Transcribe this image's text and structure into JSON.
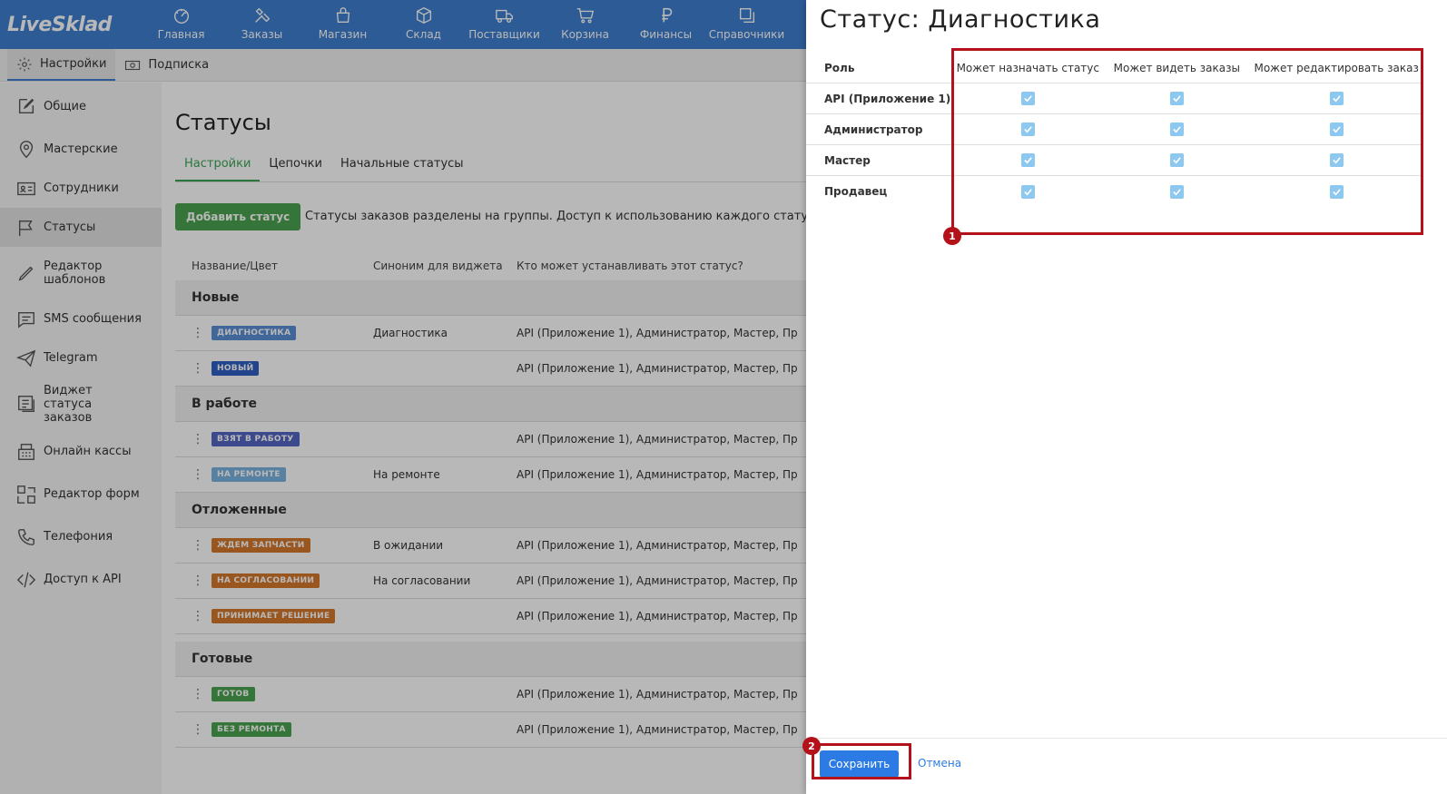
{
  "app": {
    "logo": "LiveSklad"
  },
  "topnav": [
    {
      "label": "Главная",
      "icon": "dashboard-icon"
    },
    {
      "label": "Заказы",
      "icon": "tools-icon"
    },
    {
      "label": "Магазин",
      "icon": "shop-bag-icon"
    },
    {
      "label": "Склад",
      "icon": "box-icon"
    },
    {
      "label": "Поставщики",
      "icon": "truck-icon"
    },
    {
      "label": "Корзина",
      "icon": "cart-icon"
    },
    {
      "label": "Финансы",
      "icon": "ruble-icon"
    },
    {
      "label": "Справочники",
      "icon": "copy-icon"
    }
  ],
  "subbar": {
    "settings_label": "Настройки",
    "subscription_label": "Подписка"
  },
  "sidebar": {
    "items": [
      {
        "label": "Общие",
        "icon": "edit-icon"
      },
      {
        "label": "Мастерские",
        "icon": "location-pin-icon"
      },
      {
        "label": "Сотрудники",
        "icon": "id-card-icon"
      },
      {
        "label": "Статусы",
        "icon": "flag-icon"
      },
      {
        "label": "Редактор шаблонов",
        "icon": "pen-icon"
      },
      {
        "label": "SMS сообщения",
        "icon": "message-icon"
      },
      {
        "label": "Telegram",
        "icon": "send-icon"
      },
      {
        "label": "Виджет статуса заказов",
        "icon": "widget-icon"
      },
      {
        "label": "Онлайн кассы",
        "icon": "cash-register-icon"
      },
      {
        "label": "Редактор форм",
        "icon": "form-editor-icon"
      },
      {
        "label": "Телефония",
        "icon": "phone-icon"
      },
      {
        "label": "Доступ к API",
        "icon": "code-icon"
      }
    ]
  },
  "main": {
    "title": "Статусы",
    "tabs": [
      "Настройки",
      "Цепочки",
      "Начальные статусы"
    ],
    "add_button": "Добавить статус",
    "info_text": "Статусы заказов разделены на группы. Доступ к использованию каждого статуса можно",
    "columns": [
      "Название/Цвет",
      "Синоним для виджета",
      "Кто может устанавливать этот статус?"
    ],
    "groups": [
      {
        "name": "Новые",
        "rows": [
          {
            "badge": "ДИАГНОСТИКА",
            "color": "#5b8fd6",
            "synonym": "Диагностика",
            "who": "API (Приложение 1), Администратор, Мастер, Пр"
          },
          {
            "badge": "НОВЫЙ",
            "color": "#2f5fc4",
            "synonym": "",
            "who": "API (Приложение 1), Администратор, Мастер, Пр"
          }
        ]
      },
      {
        "name": "В работе",
        "rows": [
          {
            "badge": "ВЗЯТ В РАБОТУ",
            "color": "#5466c2",
            "synonym": "",
            "who": "API (Приложение 1), Администратор, Мастер, Пр"
          },
          {
            "badge": "НА РЕМОНТЕ",
            "color": "#7ab3e0",
            "synonym": "На ремонте",
            "who": "API (Приложение 1), Администратор, Мастер, Пр"
          }
        ]
      },
      {
        "name": "Отложенные",
        "rows": [
          {
            "badge": "ЖДЕМ ЗАПЧАСТИ",
            "color": "#d6782c",
            "synonym": "В ожидании",
            "who": "API (Приложение 1), Администратор, Мастер, Пр"
          },
          {
            "badge": "НА СОГЛАСОВАНИИ",
            "color": "#d6782c",
            "synonym": "На согласовании",
            "who": "API (Приложение 1), Администратор, Мастер, Пр"
          },
          {
            "badge": "ПРИНИМАЕТ РЕШЕНИЕ",
            "color": "#d6782c",
            "synonym": "",
            "who": "API (Приложение 1), Администратор, Мастер, Пр"
          }
        ]
      },
      {
        "name": "Готовые",
        "rows": [
          {
            "badge": "ГОТОВ",
            "color": "#4aa24f",
            "synonym": "",
            "who": "API (Приложение 1), Администратор, Мастер, Пр"
          },
          {
            "badge": "БЕЗ РЕМОНТА",
            "color": "#4aa24f",
            "synonym": "",
            "who": "API (Приложение 1), Администратор, Мастер, Пр"
          }
        ]
      }
    ]
  },
  "panel": {
    "title": "Статус: Диагностика",
    "columns": [
      "Роль",
      "Может назначать статус",
      "Может видеть заказы",
      "Может редактировать заказ"
    ],
    "roles": [
      {
        "name": "API (Приложение 1)",
        "assign": true,
        "view": true,
        "edit": true
      },
      {
        "name": "Администратор",
        "assign": true,
        "view": true,
        "edit": true
      },
      {
        "name": "Мастер",
        "assign": true,
        "view": true,
        "edit": true
      },
      {
        "name": "Продавец",
        "assign": true,
        "view": true,
        "edit": true
      }
    ],
    "save_label": "Сохранить",
    "cancel_label": "Отмена"
  },
  "annotations": [
    {
      "number": "1"
    },
    {
      "number": "2"
    }
  ],
  "colors": {
    "topbar": "#3f7fd0",
    "accent_green": "#4aa24f",
    "save_blue": "#2c7be5",
    "annotation_red": "#b3121b",
    "checkbox": "#8cc8f0"
  }
}
